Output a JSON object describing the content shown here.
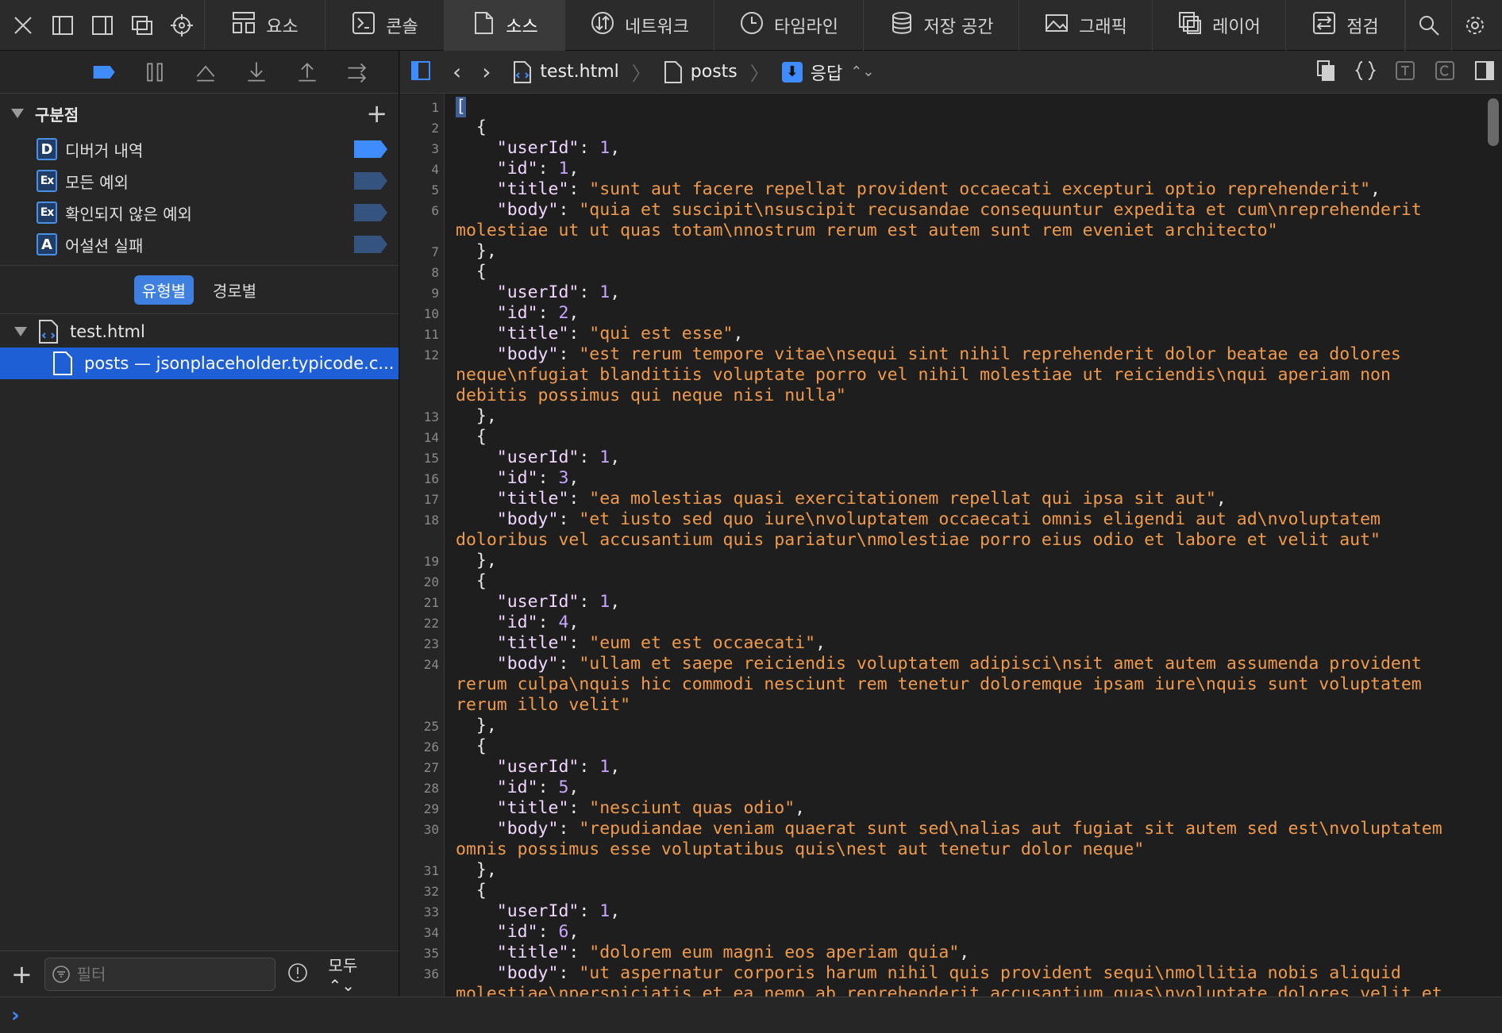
{
  "tabs": [
    {
      "label": "요소",
      "icon": "elements-icon"
    },
    {
      "label": "콘솔",
      "icon": "console-icon"
    },
    {
      "label": "소스",
      "icon": "sources-icon",
      "active": true
    },
    {
      "label": "네트워크",
      "icon": "network-icon"
    },
    {
      "label": "타임라인",
      "icon": "timeline-icon"
    },
    {
      "label": "저장 공간",
      "icon": "storage-icon"
    },
    {
      "label": "그래픽",
      "icon": "graphics-icon"
    },
    {
      "label": "레이어",
      "icon": "layers-icon"
    },
    {
      "label": "점검",
      "icon": "audit-icon"
    }
  ],
  "sidebar": {
    "breakpoints_title": "구분점",
    "breakpoints": [
      {
        "badge": "D",
        "label": "디버거 내역",
        "enabled": true
      },
      {
        "badge": "Ex",
        "label": "모든 예외",
        "enabled": false
      },
      {
        "badge": "Ex",
        "label": "확인되지 않은 예외",
        "enabled": false
      },
      {
        "badge": "A",
        "label": "어설션 실패",
        "enabled": false
      }
    ],
    "group_by": {
      "type": "유형별",
      "path": "경로별",
      "selected": "유형별"
    },
    "tree": {
      "file": "test.html",
      "child": "posts — jsonplaceholder.typicode.c..."
    },
    "filter_placeholder": "필터",
    "scope": "모두"
  },
  "content": {
    "breadcrumb": {
      "file": "test.html",
      "resource": "posts",
      "mode": "응답"
    },
    "accent": "#3f8cff",
    "string_color": "#f09a4c"
  },
  "code_lines": [
    {
      "num": "1",
      "text": "["
    },
    {
      "num": "2",
      "text": "  {"
    },
    {
      "num": "3",
      "text": "    \"userId\": 1,"
    },
    {
      "num": "4",
      "text": "    \"id\": 1,"
    },
    {
      "num": "5",
      "text": "    \"title\": \"sunt aut facere repellat provident occaecati excepturi optio reprehenderit\","
    },
    {
      "num": "6",
      "text": "    \"body\": \"quia et suscipit\\nsuscipit recusandae consequuntur expedita et cum\\nreprehenderit"
    },
    {
      "num": "",
      "text": "molestiae ut ut quas totam\\nnostrum rerum est autem sunt rem eveniet architecto\""
    },
    {
      "num": "7",
      "text": "  },"
    },
    {
      "num": "8",
      "text": "  {"
    },
    {
      "num": "9",
      "text": "    \"userId\": 1,"
    },
    {
      "num": "10",
      "text": "    \"id\": 2,"
    },
    {
      "num": "11",
      "text": "    \"title\": \"qui est esse\","
    },
    {
      "num": "12",
      "text": "    \"body\": \"est rerum tempore vitae\\nsequi sint nihil reprehenderit dolor beatae ea dolores"
    },
    {
      "num": "",
      "text": "neque\\nfugiat blanditiis voluptate porro vel nihil molestiae ut reiciendis\\nqui aperiam non"
    },
    {
      "num": "",
      "text": "debitis possimus qui neque nisi nulla\""
    },
    {
      "num": "13",
      "text": "  },"
    },
    {
      "num": "14",
      "text": "  {"
    },
    {
      "num": "15",
      "text": "    \"userId\": 1,"
    },
    {
      "num": "16",
      "text": "    \"id\": 3,"
    },
    {
      "num": "17",
      "text": "    \"title\": \"ea molestias quasi exercitationem repellat qui ipsa sit aut\","
    },
    {
      "num": "18",
      "text": "    \"body\": \"et iusto sed quo iure\\nvoluptatem occaecati omnis eligendi aut ad\\nvoluptatem"
    },
    {
      "num": "",
      "text": "doloribus vel accusantium quis pariatur\\nmolestiae porro eius odio et labore et velit aut\""
    },
    {
      "num": "19",
      "text": "  },"
    },
    {
      "num": "20",
      "text": "  {"
    },
    {
      "num": "21",
      "text": "    \"userId\": 1,"
    },
    {
      "num": "22",
      "text": "    \"id\": 4,"
    },
    {
      "num": "23",
      "text": "    \"title\": \"eum et est occaecati\","
    },
    {
      "num": "24",
      "text": "    \"body\": \"ullam et saepe reiciendis voluptatem adipisci\\nsit amet autem assumenda provident"
    },
    {
      "num": "",
      "text": "rerum culpa\\nquis hic commodi nesciunt rem tenetur doloremque ipsam iure\\nquis sunt voluptatem"
    },
    {
      "num": "",
      "text": "rerum illo velit\""
    },
    {
      "num": "25",
      "text": "  },"
    },
    {
      "num": "26",
      "text": "  {"
    },
    {
      "num": "27",
      "text": "    \"userId\": 1,"
    },
    {
      "num": "28",
      "text": "    \"id\": 5,"
    },
    {
      "num": "29",
      "text": "    \"title\": \"nesciunt quas odio\","
    },
    {
      "num": "30",
      "text": "    \"body\": \"repudiandae veniam quaerat sunt sed\\nalias aut fugiat sit autem sed est\\nvoluptatem"
    },
    {
      "num": "",
      "text": "omnis possimus esse voluptatibus quis\\nest aut tenetur dolor neque\""
    },
    {
      "num": "31",
      "text": "  },"
    },
    {
      "num": "32",
      "text": "  {"
    },
    {
      "num": "33",
      "text": "    \"userId\": 1,"
    },
    {
      "num": "34",
      "text": "    \"id\": 6,"
    },
    {
      "num": "35",
      "text": "    \"title\": \"dolorem eum magni eos aperiam quia\","
    },
    {
      "num": "36",
      "text": "    \"body\": \"ut aspernatur corporis harum nihil quis provident sequi\\nmollitia nobis aliquid"
    },
    {
      "num": "",
      "text": "molestiae\\nperspiciatis et ea nemo ab reprehenderit accusantium quas\\nvoluptate dolores velit et"
    }
  ]
}
